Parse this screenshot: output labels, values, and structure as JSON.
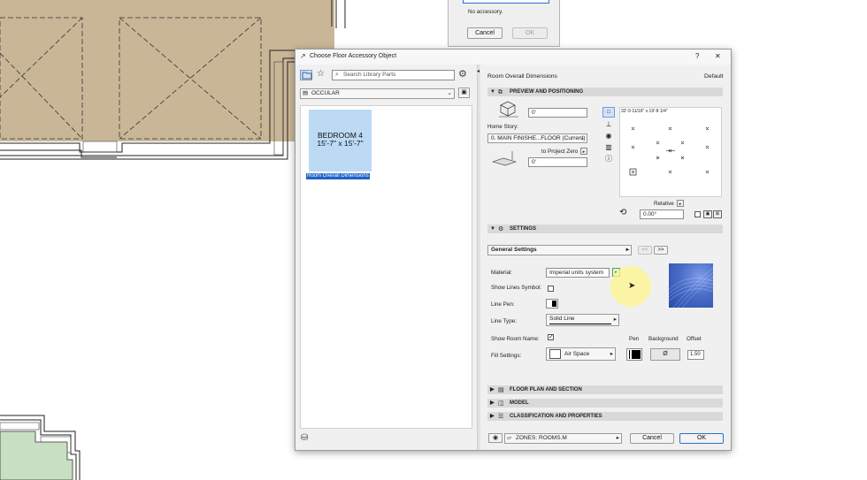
{
  "mini_dialog": {
    "message": "No accessory.",
    "cancel_label": "Cancel",
    "ok_label": "OK"
  },
  "dialog": {
    "title": "Choose Floor Accessory Object",
    "help_label": "?",
    "close_label": "✕",
    "left": {
      "search_placeholder": "Search Library Parts",
      "folder_label": "OCCULAR",
      "thumbnail": {
        "line1": "BEDROOM 4",
        "line2": "15'-7\" x 15'-7\"",
        "caption": "Room Overall Dimensions"
      }
    },
    "right": {
      "object_name": "Room Overall Dimensions",
      "default_label": "Default",
      "preview_section": "PREVIEW AND POSITIONING",
      "height_value": "0'",
      "home_story_label": "Home Story:",
      "home_story_value": "0. MAIN FINISHE...FLOOR (Current)",
      "to_project_zero_label": "to Project Zero",
      "offset_value": "0'",
      "preview_dimension": "32'-9 11/16\" x 19'-8 1/4\"",
      "relative_label": "Relative",
      "angle_value": "0.00°",
      "settings_section": "SETTINGS",
      "general_settings_label": "General Settings",
      "prev_page_label": "<<",
      "next_page_label": ">>",
      "material_label": "Material:",
      "material_value": "Imperial units system",
      "show_lines_symbol_label": "Show Lines Symbol:",
      "line_pen_label": "Line Pen:",
      "line_type_label": "Line Type:",
      "line_type_value": "Solid Line",
      "show_room_name_label": "Show Room Name:",
      "pen_col_label": "Pen",
      "background_col_label": "Background",
      "offset_col_label": "Offset",
      "fill_settings_label": "Fill Settings:",
      "fill_value": "Air Space",
      "background_value": "Ø",
      "offset_field_value": "1.50",
      "floor_plan_section": "FLOOR PLAN AND SECTION",
      "model_section": "MODEL",
      "classification_section": "CLASSIFICATION AND PROPERTIES",
      "layer_value": "ZONES: ROOMS.M",
      "cancel_label": "Cancel",
      "ok_label": "OK"
    }
  },
  "colors": {
    "floor_fill": "#c9b697",
    "green_fill": "#c8dfc2",
    "selection_blue": "#1f62c9",
    "thumb_blue": "#bcdaf4",
    "accent_green": "#5aa23c"
  }
}
